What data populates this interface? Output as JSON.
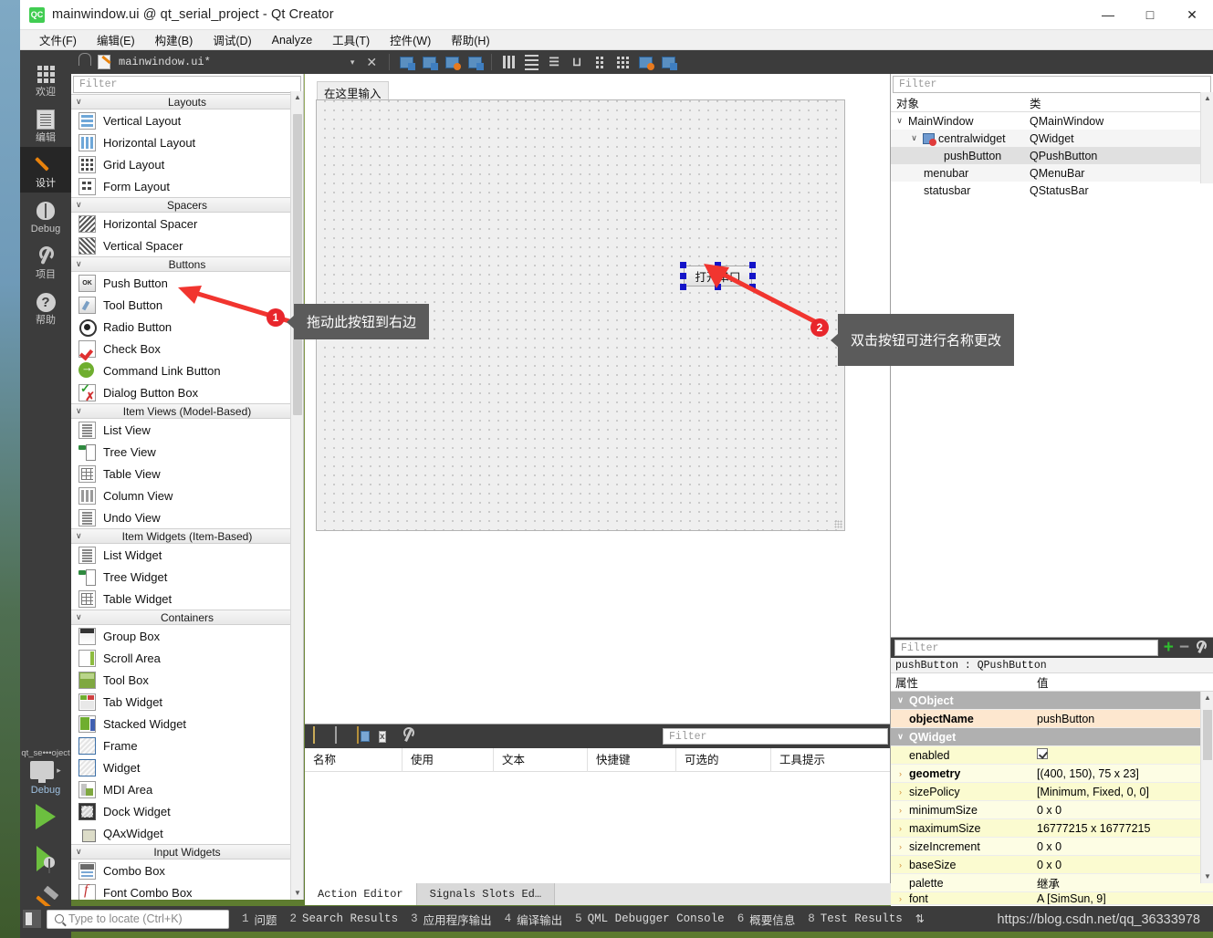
{
  "window": {
    "title": "mainwindow.ui @ qt_serial_project - Qt Creator",
    "logo_text": "QC",
    "minimize": "—",
    "maximize": "□",
    "close": "✕"
  },
  "menubar": {
    "items": [
      {
        "label": "文件(F)"
      },
      {
        "label": "编辑(E)"
      },
      {
        "label": "构建(B)"
      },
      {
        "label": "调试(D)"
      },
      {
        "label": "Analyze"
      },
      {
        "label": "工具(T)"
      },
      {
        "label": "控件(W)"
      },
      {
        "label": "帮助(H)"
      }
    ]
  },
  "modebar": {
    "items": [
      {
        "label": "欢迎",
        "icon": "grid-icon"
      },
      {
        "label": "编辑",
        "icon": "document-icon"
      },
      {
        "label": "设计",
        "icon": "pencil-icon"
      },
      {
        "label": "Debug",
        "icon": "bug-icon"
      },
      {
        "label": "项目",
        "icon": "wrench-icon"
      },
      {
        "label": "帮助",
        "icon": "help-icon"
      }
    ],
    "kit": {
      "project": "qt_se•••oject",
      "build_config": "Debug",
      "caret": "▸"
    }
  },
  "editor_toolbar": {
    "filename": "mainwindow.ui*",
    "dropdown_caret": "▾",
    "close_x": "✕"
  },
  "widget_box": {
    "filter_placeholder": "Filter",
    "groups": [
      {
        "title": "Layouts",
        "chevron": "∨",
        "items": [
          {
            "label": "Vertical Layout",
            "icon": "vertical-layout-icon"
          },
          {
            "label": "Horizontal Layout",
            "icon": "horizontal-layout-icon"
          },
          {
            "label": "Grid Layout",
            "icon": "grid-layout-icon"
          },
          {
            "label": "Form Layout",
            "icon": "form-layout-icon"
          }
        ]
      },
      {
        "title": "Spacers",
        "chevron": "∨",
        "items": [
          {
            "label": "Horizontal Spacer",
            "icon": "horizontal-spacer-icon"
          },
          {
            "label": "Vertical Spacer",
            "icon": "vertical-spacer-icon"
          }
        ]
      },
      {
        "title": "Buttons",
        "chevron": "∨",
        "items": [
          {
            "label": "Push Button",
            "icon": "push-button-icon"
          },
          {
            "label": "Tool Button",
            "icon": "tool-button-icon"
          },
          {
            "label": "Radio Button",
            "icon": "radio-button-icon"
          },
          {
            "label": "Check Box",
            "icon": "check-box-icon"
          },
          {
            "label": "Command Link Button",
            "icon": "command-link-icon"
          },
          {
            "label": "Dialog Button Box",
            "icon": "dialog-button-box-icon"
          }
        ]
      },
      {
        "title": "Item Views (Model-Based)",
        "chevron": "∨",
        "items": [
          {
            "label": "List View",
            "icon": "list-view-icon"
          },
          {
            "label": "Tree View",
            "icon": "tree-view-icon"
          },
          {
            "label": "Table View",
            "icon": "table-view-icon"
          },
          {
            "label": "Column View",
            "icon": "column-view-icon"
          },
          {
            "label": "Undo View",
            "icon": "undo-view-icon"
          }
        ]
      },
      {
        "title": "Item Widgets (Item-Based)",
        "chevron": "∨",
        "items": [
          {
            "label": "List Widget",
            "icon": "list-widget-icon"
          },
          {
            "label": "Tree Widget",
            "icon": "tree-widget-icon"
          },
          {
            "label": "Table Widget",
            "icon": "table-widget-icon"
          }
        ]
      },
      {
        "title": "Containers",
        "chevron": "∨",
        "items": [
          {
            "label": "Group Box",
            "icon": "group-box-icon"
          },
          {
            "label": "Scroll Area",
            "icon": "scroll-area-icon"
          },
          {
            "label": "Tool Box",
            "icon": "tool-box-icon"
          },
          {
            "label": "Tab Widget",
            "icon": "tab-widget-icon"
          },
          {
            "label": "Stacked Widget",
            "icon": "stacked-widget-icon"
          },
          {
            "label": "Frame",
            "icon": "frame-icon"
          },
          {
            "label": "Widget",
            "icon": "widget-icon"
          },
          {
            "label": "MDI Area",
            "icon": "mdi-area-icon"
          },
          {
            "label": "Dock Widget",
            "icon": "dock-widget-icon"
          },
          {
            "label": "QAxWidget",
            "icon": "qax-widget-icon"
          }
        ]
      },
      {
        "title": "Input Widgets",
        "chevron": "∨",
        "items": [
          {
            "label": "Combo Box",
            "icon": "combo-box-icon"
          },
          {
            "label": "Font Combo Box",
            "icon": "font-combo-box-icon"
          }
        ]
      }
    ]
  },
  "canvas": {
    "menu_hint": "在这里输入",
    "button_text": "打开串口"
  },
  "annotations": [
    {
      "number": "1",
      "text": "拖动此按钮到右边"
    },
    {
      "number": "2",
      "text": "双击按钮可进行名称更改"
    }
  ],
  "action_editor": {
    "filter_placeholder": "Filter",
    "columns": [
      "名称",
      "使用",
      "文本",
      "快捷键",
      "可选的",
      "工具提示"
    ],
    "tabs": [
      {
        "label": "Action Editor",
        "active": true
      },
      {
        "label": "Signals Slots Ed…",
        "active": false
      }
    ],
    "toolbar_icons": [
      "new-action-icon",
      "copy-icon",
      "paste-icon",
      "delete-icon",
      "configure-icon"
    ]
  },
  "object_inspector": {
    "filter_placeholder": "Filter",
    "columns": [
      "对象",
      "类"
    ],
    "rows": [
      {
        "indent": 0,
        "chevron": "∨",
        "name": "MainWindow",
        "cls": "QMainWindow",
        "selected": false,
        "icon": ""
      },
      {
        "indent": 1,
        "chevron": "∨",
        "name": "centralwidget",
        "cls": "QWidget",
        "selected": false,
        "icon": "central-widget-icon"
      },
      {
        "indent": 2,
        "chevron": "",
        "name": "pushButton",
        "cls": "QPushButton",
        "selected": true,
        "icon": ""
      },
      {
        "indent": 1,
        "chevron": "",
        "name": "menubar",
        "cls": "QMenuBar",
        "selected": false,
        "icon": ""
      },
      {
        "indent": 1,
        "chevron": "",
        "name": "statusbar",
        "cls": "QStatusBar",
        "selected": false,
        "icon": ""
      }
    ]
  },
  "property_editor": {
    "filter_placeholder": "Filter",
    "add_icon": "+",
    "remove_icon": "−",
    "configure_icon": "configure-icon",
    "subtitle": "pushButton : QPushButton",
    "columns": [
      "属性",
      "值"
    ],
    "rows": [
      {
        "kind": "group",
        "chevron": "∨",
        "name": "QObject",
        "value": ""
      },
      {
        "kind": "obj",
        "chevron": "",
        "name": "objectName",
        "value": "pushButton",
        "bold": true
      },
      {
        "kind": "group",
        "chevron": "∨",
        "name": "QWidget",
        "value": ""
      },
      {
        "kind": "yel",
        "chevron": "",
        "name": "enabled",
        "value": "",
        "checkbox": true
      },
      {
        "kind": "yel2",
        "chevron": "›",
        "name": "geometry",
        "value": "[(400, 150), 75 x 23]",
        "bold": true
      },
      {
        "kind": "yel",
        "chevron": "›",
        "name": "sizePolicy",
        "value": "[Minimum, Fixed, 0, 0]"
      },
      {
        "kind": "yel2",
        "chevron": "›",
        "name": "minimumSize",
        "value": "0 x 0"
      },
      {
        "kind": "yel",
        "chevron": "›",
        "name": "maximumSize",
        "value": "16777215 x 16777215"
      },
      {
        "kind": "yel2",
        "chevron": "›",
        "name": "sizeIncrement",
        "value": "0 x 0"
      },
      {
        "kind": "yel",
        "chevron": "›",
        "name": "baseSize",
        "value": "0 x 0"
      },
      {
        "kind": "yel2",
        "chevron": "",
        "name": "palette",
        "value": "继承"
      },
      {
        "kind": "yel",
        "chevron": "›",
        "name": "font",
        "value": "A  [SimSun, 9]"
      }
    ]
  },
  "statusbar": {
    "locator_placeholder": "Type to locate (Ctrl+K)",
    "outputs": [
      {
        "num": "1",
        "label": "问题"
      },
      {
        "num": "2",
        "label": "Search Results"
      },
      {
        "num": "3",
        "label": "应用程序输出"
      },
      {
        "num": "4",
        "label": "编译输出"
      },
      {
        "num": "5",
        "label": "QML Debugger Console"
      },
      {
        "num": "6",
        "label": "概要信息"
      },
      {
        "num": "8",
        "label": "Test Results"
      }
    ],
    "updown": "⇅"
  },
  "watermark": "https://blog.csdn.net/qq_36333978",
  "colors": {
    "accent_red": "#e8262c",
    "qt_green": "#41cd52",
    "dark_chrome": "#3c3c3c",
    "selection": "#e0e0e0"
  }
}
